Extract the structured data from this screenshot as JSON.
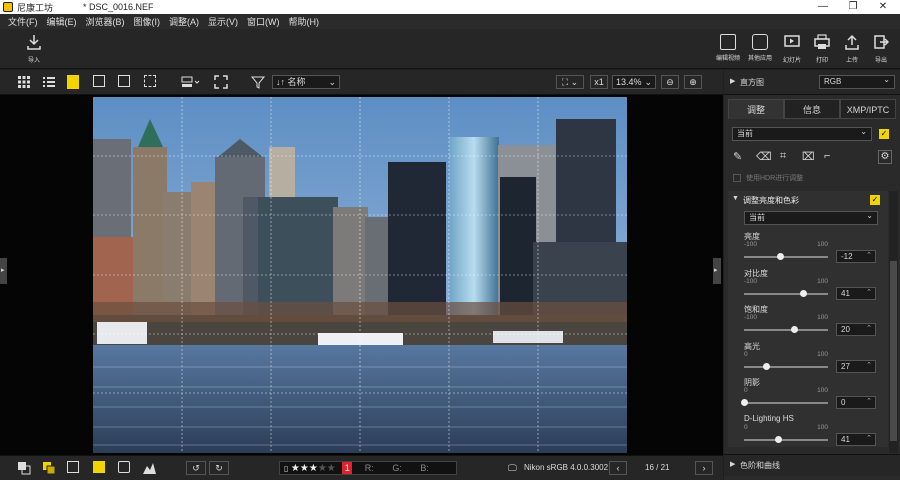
{
  "window": {
    "app_title": "尼康工坊",
    "file_title": "* DSC_0016.NEF",
    "min": "—",
    "restore": "❐",
    "close": "✕"
  },
  "menu": [
    "文件(F)",
    "编辑(E)",
    "浏览器(B)",
    "图像(I)",
    "调整(A)",
    "显示(V)",
    "窗口(W)",
    "帮助(H)"
  ],
  "toolbar": {
    "import_label": "导入",
    "right_buttons": [
      {
        "label": "编辑视频",
        "icon": "edit-video-icon"
      },
      {
        "label": "其他应用",
        "icon": "other-apps-icon"
      },
      {
        "label": "幻灯片",
        "icon": "slideshow-icon"
      },
      {
        "label": "打印",
        "icon": "print-icon"
      },
      {
        "label": "上传",
        "icon": "upload-icon"
      },
      {
        "label": "导出",
        "icon": "export-icon"
      }
    ]
  },
  "viewbar": {
    "sort_label": "名称",
    "zoom_mult": "x1",
    "zoom_level": "13.4%"
  },
  "status": {
    "rating_stars_filled": 3,
    "rating_stars_total": 5,
    "label_tag": "1",
    "r_label": "R:",
    "g_label": "G:",
    "b_label": "B:",
    "color_profile": "Nikon sRGB 4.0.0.3002",
    "page_counter": "16 / 21"
  },
  "right_panel": {
    "histogram_label": "直方图",
    "histogram_mode": "RGB",
    "tabs": [
      "调整",
      "信息",
      "XMP/IPTC"
    ],
    "preset_select": "当前",
    "hdr_label": "使用HDR进行调整",
    "section_title": "调整亮度和色彩",
    "section_preset": "当前",
    "sliders": [
      {
        "label": "亮度",
        "min": "-100",
        "max": "100",
        "value": "-12"
      },
      {
        "label": "对比度",
        "min": "-100",
        "max": "100",
        "value": "41"
      },
      {
        "label": "饱和度",
        "min": "-100",
        "max": "100",
        "value": "20"
      },
      {
        "label": "高光",
        "min": "0",
        "max": "100",
        "value": "27"
      },
      {
        "label": "阴影",
        "min": "0",
        "max": "100",
        "value": "0"
      },
      {
        "label": "D-Lighting HS",
        "min": "0",
        "max": "100",
        "value": "41"
      }
    ],
    "next_section": "色阶和曲线"
  },
  "colors": {
    "accent_yellow": "#f2d400",
    "label_red": "#e0232a"
  }
}
